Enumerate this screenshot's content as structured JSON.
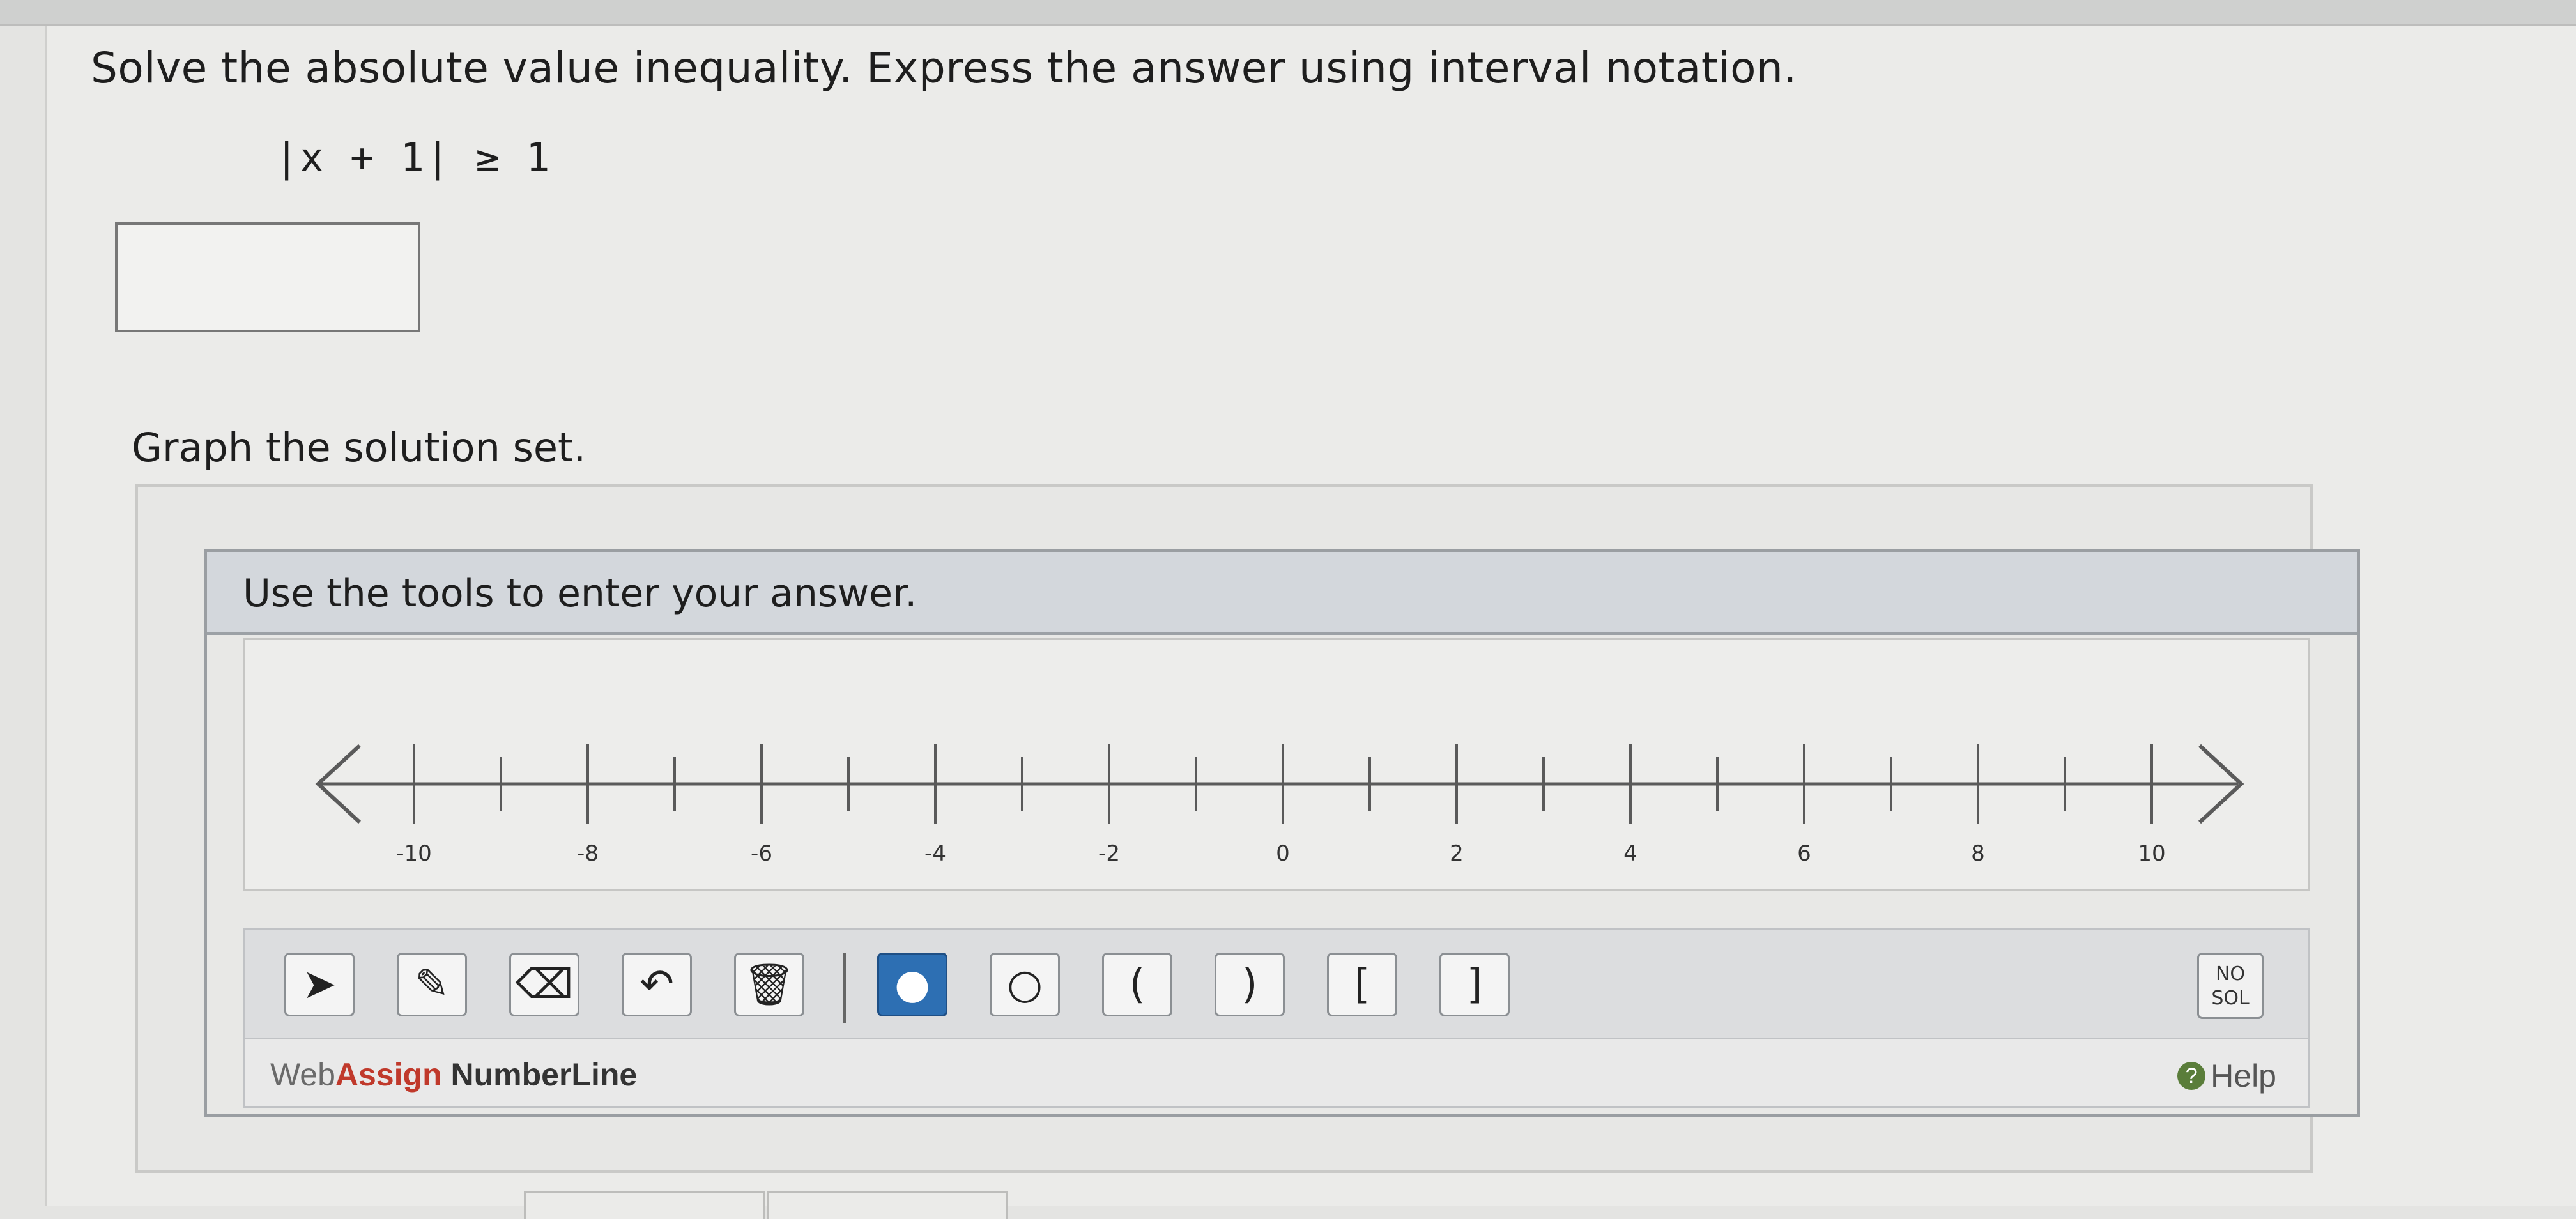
{
  "question": {
    "prompt": "Solve the absolute value inequality. Express the answer using interval notation.",
    "equation": "|x + 1| ≥ 1",
    "answer_value": "",
    "graph_label": "Graph the solution set."
  },
  "widget": {
    "header": "Use the tools to enter your answer.",
    "numberline": {
      "min": -10,
      "max": 10,
      "tick_step": 1,
      "label_values": [
        "-10",
        "-8",
        "-6",
        "-4",
        "-2",
        "0",
        "2",
        "4",
        "6",
        "8",
        "10"
      ]
    },
    "tools": [
      {
        "name": "select-tool",
        "icon": "arrow-pointer-icon",
        "glyph": "➤"
      },
      {
        "name": "draw-tool",
        "icon": "pencil-icon",
        "glyph": "✎"
      },
      {
        "name": "erase-tool",
        "icon": "eraser-icon",
        "glyph": "⌫"
      },
      {
        "name": "undo-tool",
        "icon": "undo-icon",
        "glyph": "↶"
      },
      {
        "name": "clear-tool",
        "icon": "trash-icon",
        "glyph": "🗑"
      },
      {
        "name": "closed-point-tool",
        "icon": "filled-circle-icon",
        "glyph": "●"
      },
      {
        "name": "open-point-tool",
        "icon": "open-circle-icon",
        "glyph": "○"
      },
      {
        "name": "open-left-paren-tool",
        "icon": "left-paren-icon",
        "glyph": "("
      },
      {
        "name": "open-right-paren-tool",
        "icon": "right-paren-icon",
        "glyph": ")"
      },
      {
        "name": "closed-left-bracket-tool",
        "icon": "left-bracket-icon",
        "glyph": "["
      },
      {
        "name": "closed-right-bracket-tool",
        "icon": "right-bracket-icon",
        "glyph": "]"
      }
    ],
    "nosol_line1": "NO",
    "nosol_line2": "SOL",
    "brand_web": "Web",
    "brand_assign": "Assign",
    "brand_product": " NumberLine",
    "help_label": "Help"
  },
  "colors": {
    "active_tool": "#2d6fb3",
    "brand_red": "#c0392b",
    "help_green": "#5a7d3a"
  }
}
